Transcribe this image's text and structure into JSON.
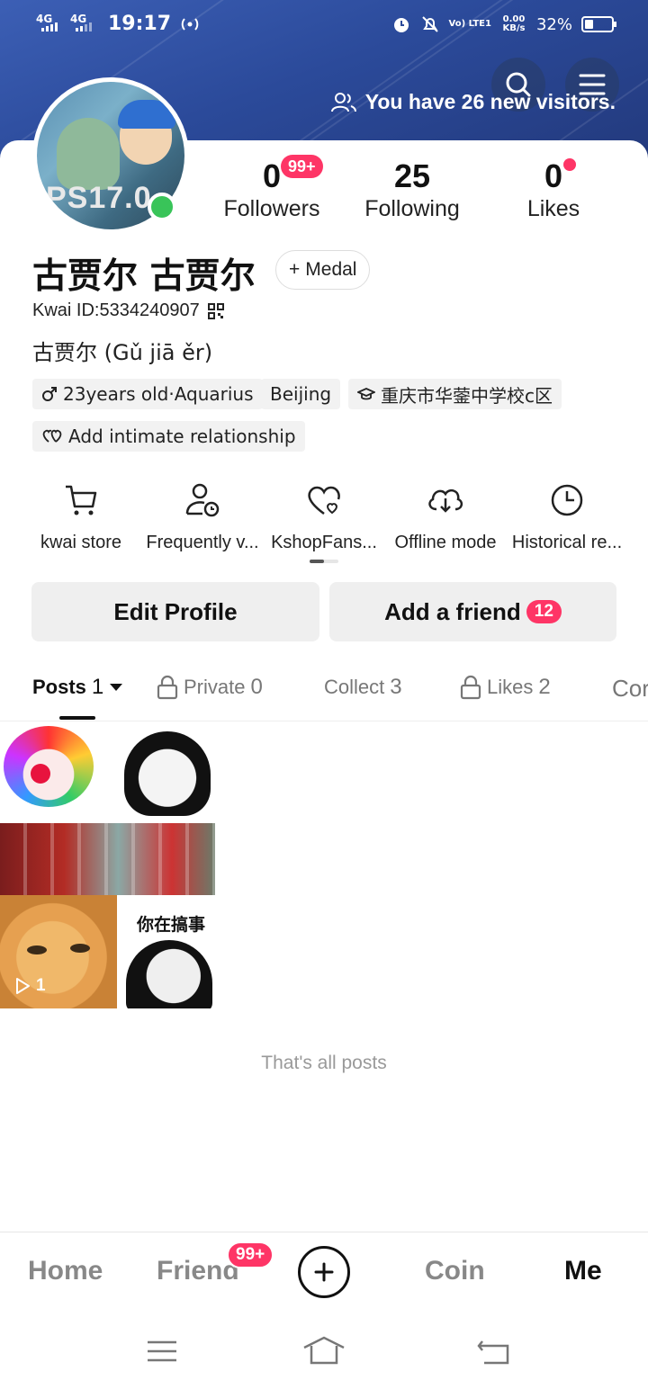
{
  "status_bar": {
    "signal1": "4G",
    "signal2": "4G",
    "time": "19:17",
    "volte": "Vo) LTE1",
    "speed": "0.00 KB/s",
    "battery": "32%"
  },
  "header": {
    "visitors_text": "You have 26 new visitors."
  },
  "profile": {
    "avatar_text": "PS17.0",
    "stats": {
      "followers_count": "0",
      "followers_badge": "99+",
      "followers_label": "Followers",
      "following_count": "25",
      "following_label": "Following",
      "likes_count": "0",
      "likes_label": "Likes"
    },
    "name": "古贾尔 古贾尔",
    "medal_label": "Medal",
    "kwai_id": "Kwai ID:5334240907",
    "bio": "古贾尔 (Gǔ jiā ěr)",
    "tags": {
      "age": "23years old·Aquarius",
      "city": "Beijing",
      "school": "重庆市华蓥中学校c区",
      "relationship": "Add intimate relationship"
    }
  },
  "shortcuts": [
    {
      "label": "kwai store",
      "icon": "cart-icon"
    },
    {
      "label": "Frequently v...",
      "icon": "user-clock-icon"
    },
    {
      "label": "KshopFans...",
      "icon": "heart-icon"
    },
    {
      "label": "Offline mode",
      "icon": "download-cloud-icon"
    },
    {
      "label": "Historical re...",
      "icon": "clock-icon"
    }
  ],
  "actions": {
    "edit_profile": "Edit Profile",
    "add_friend": "Add a friend",
    "add_friend_badge": "12"
  },
  "tabs": [
    {
      "label": "Posts",
      "count": "1"
    },
    {
      "label": "Private",
      "count": "0"
    },
    {
      "label": "Collect",
      "count": "3"
    },
    {
      "label": "Likes",
      "count": "2"
    },
    {
      "label": "Cor",
      "count": ""
    }
  ],
  "post": {
    "caption_text": "你在搞事",
    "play_count": "1"
  },
  "end_text": "That's all posts",
  "bottom_nav": {
    "home": "Home",
    "friend": "Friend",
    "friend_badge": "99+",
    "coin": "Coin",
    "me": "Me"
  },
  "colors": {
    "accent": "#fe3566",
    "online": "#39c459",
    "banner": "#2b4a9a"
  }
}
